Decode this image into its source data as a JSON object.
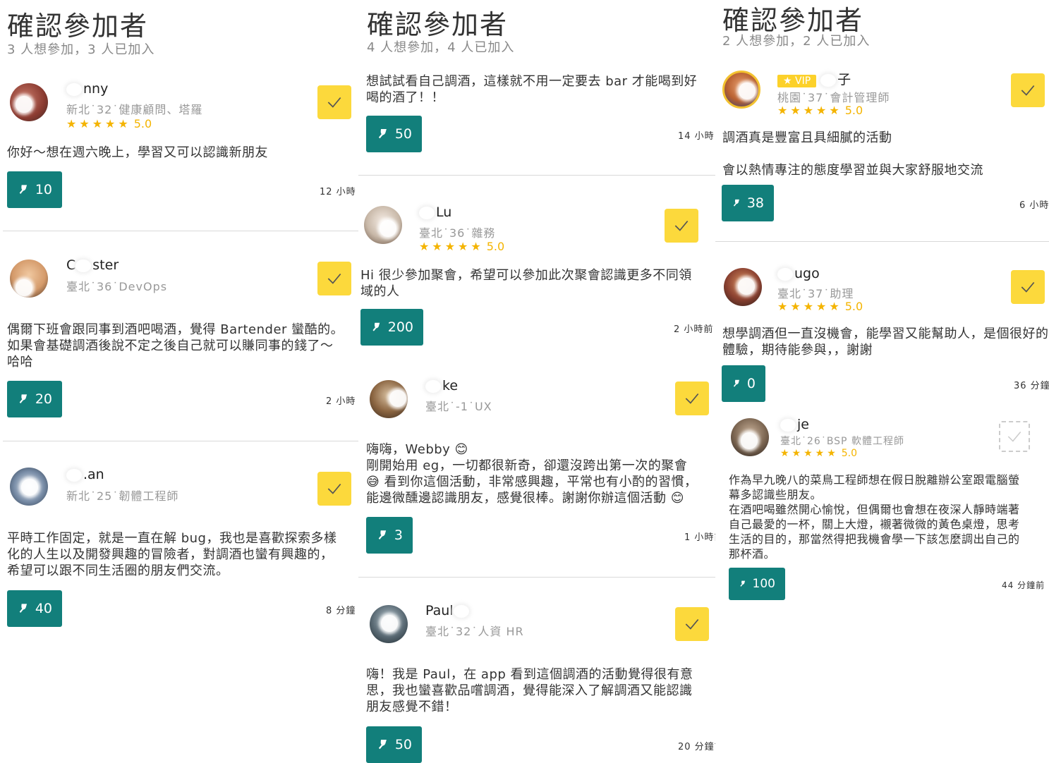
{
  "colors": {
    "teal": "#127f7b",
    "yellow": "#fcd93c",
    "star": "#f4b400"
  },
  "panels": [
    {
      "title": "確認參加者",
      "subtitle": "3 人想參加，3 人已加入",
      "cards": [
        {
          "name": "nny",
          "meta": "新北˙32˙健康顧問、塔羅",
          "stars": "★★★★★",
          "score": "5.0",
          "message": "你好～想在週六晚上，學習又可以認識新朋友",
          "votes": "10",
          "time": "12 小時"
        },
        {
          "name": "ster",
          "name_prefix": "C",
          "meta": "臺北˙36˙DevOps",
          "message": "偶爾下班會跟同事到酒吧喝酒，覺得 Bartender 蠻酷的。\n如果會基礎調酒後說不定之後自己就可以賺同事的錢了～\n哈哈",
          "votes": "20",
          "time": "2 小時"
        },
        {
          "name": ".an",
          "meta": "新北˙25˙韌體工程師",
          "message": "平時工作固定，就是一直在解 bug，我也是喜歡探索多樣\n化的人生以及開發興趣的冒險者，對調酒也蠻有興趣的，\n希望可以跟不同生活圈的朋友們交流。",
          "votes": "40",
          "time": "8 分鐘"
        }
      ]
    },
    {
      "title": "確認參加者",
      "subtitle": "4 人想參加，4 人已加入",
      "cards": [
        {
          "message": "想試試看自己調酒，這樣就不用一定要去 bar 才能喝到好\n喝的酒了！！",
          "votes": "50",
          "time": "14 小時"
        },
        {
          "name": "Lu",
          "meta": "臺北˙36˙雜務",
          "stars": "★★★★★",
          "score": "5.0",
          "message": "Hi 很少參加聚會，希望可以參加此次聚會認識更多不同領\n域的人",
          "votes": "200",
          "time": "2 小時前"
        },
        {
          "name": "ke",
          "meta": "臺北˙-1˙UX",
          "message": "嗨嗨，Webby 😊\n剛開始用 eg，一切都很新奇，卻還沒跨出第一次的聚會\n😅 看到你這個活動，非常感興趣，平常也有小酌的習慣，\n能邊微醺邊認識朋友，感覺很棒。謝謝你辦這個活動 😊",
          "votes": "3",
          "time": "1 小時前"
        },
        {
          "name": "Paul",
          "meta": "臺北˙32˙人資 HR",
          "message": "嗨！我是 Paul，在 app 看到這個調酒的活動覺得很有意\n思，我也蠻喜歡品嚐調酒，覺得能深入了解調酒又能認識\n朋友感覺不錯！",
          "votes": "50",
          "time": "20 分鐘前"
        }
      ]
    },
    {
      "title": "確認參加者",
      "subtitle": "2 人想參加，2 人已加入",
      "cards": [
        {
          "vip": "VIP",
          "name": "子",
          "meta": "桃園˙37˙會計管理師",
          "stars": "★★★★★",
          "score": "5.0",
          "message": "調酒真是豐富且具細膩的活動\n\n會以熱情專注的態度學習並與大家舒服地交流",
          "votes": "38",
          "time": "6 小時"
        },
        {
          "name": "ugo",
          "meta": "臺北˙37˙助理",
          "stars": "★★★★★",
          "score": "5.0",
          "message": "想學調酒但一直沒機會，能學習又能幫助人，是個很好的\n體驗，期待能參與，，謝謝",
          "votes": "0",
          "time": "36 分鐘"
        },
        {
          "name": "je",
          "meta": "臺北˙26˙BSP 軟體工程師",
          "stars": "★★★★★",
          "score": "5.0",
          "message": "作為早九晚八的菜鳥工程師想在假日脫離辦公室跟電腦螢\n幕多認識些朋友。\n在酒吧喝雖然開心愉悅，但偶爾也會想在夜深人靜時端著\n自己最愛的一杯，關上大燈，襯著微微的黃色桌燈，思考\n生活的目的，那當然得把我機會學一下該怎麼調出自己的\n那杯酒。",
          "votes": "100",
          "time": "44 分鐘前"
        }
      ]
    }
  ]
}
